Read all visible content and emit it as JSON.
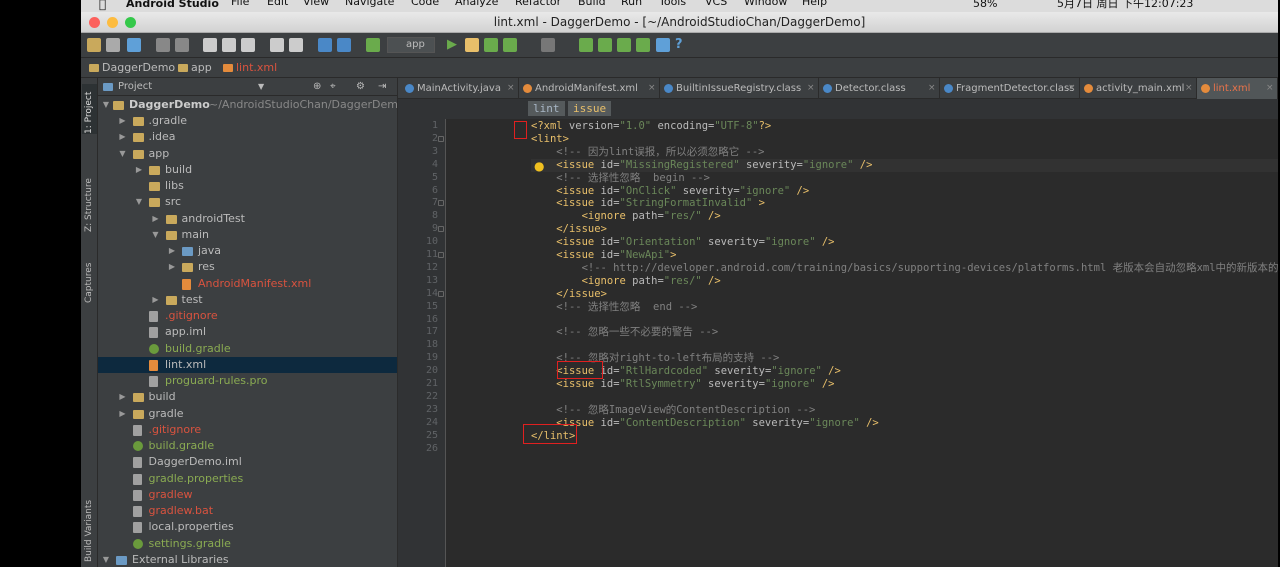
{
  "menubar": {
    "app": "Android Studio",
    "items": [
      "File",
      "Edit",
      "View",
      "Navigate",
      "Code",
      "Analyze",
      "Refactor",
      "Build",
      "Run",
      "Tools",
      "VCS",
      "Window",
      "Help"
    ],
    "battery": "58%",
    "clock": "5月7日 周日 下午12:07:23"
  },
  "window": {
    "title": "lint.xml - DaggerDemo - [~/AndroidStudioChan/DaggerDemo]"
  },
  "toolbar": {
    "run_config": "app",
    "icons": [
      "open-icon",
      "save-icon",
      "sync-icon",
      "undo-icon",
      "redo-icon",
      "cut-icon",
      "copy-icon",
      "paste-icon",
      "find-icon",
      "replace-icon",
      "back-icon",
      "forward-icon",
      "make-icon",
      "run-icon",
      "apply-changes-icon",
      "debug-icon",
      "coverage-icon",
      "stop-icon",
      "sdk-manager-icon",
      "avd-manager-icon",
      "gradle-sync-icon",
      "android-monitor-icon",
      "project-structure-icon",
      "help-icon"
    ]
  },
  "navbar": {
    "crumbs": [
      "DaggerDemo",
      "app",
      "lint.xml"
    ]
  },
  "leftstrip": {
    "tabs": [
      "1: Project",
      "Z: Structure",
      "Captures",
      "Build Variants"
    ]
  },
  "project": {
    "header": "Project",
    "root": "DaggerDemo",
    "root_path": "~/AndroidStudioChan/DaggerDemo",
    "items": [
      {
        "label": ".gradle",
        "depth": 1,
        "arrow": "▶",
        "icon": "f",
        "color": "c-white"
      },
      {
        "label": ".idea",
        "depth": 1,
        "arrow": "▶",
        "icon": "f",
        "color": "c-white"
      },
      {
        "label": "app",
        "depth": 1,
        "arrow": "▼",
        "icon": "f",
        "color": "c-white"
      },
      {
        "label": "build",
        "depth": 2,
        "arrow": "▶",
        "icon": "f",
        "color": "c-white"
      },
      {
        "label": "libs",
        "depth": 2,
        "arrow": "",
        "icon": "f",
        "color": "c-white"
      },
      {
        "label": "src",
        "depth": 2,
        "arrow": "▼",
        "icon": "f",
        "color": "c-white"
      },
      {
        "label": "androidTest",
        "depth": 3,
        "arrow": "▶",
        "icon": "f",
        "color": "c-white"
      },
      {
        "label": "main",
        "depth": 3,
        "arrow": "▼",
        "icon": "f",
        "color": "c-white"
      },
      {
        "label": "java",
        "depth": 4,
        "arrow": "▶",
        "icon": "fb",
        "color": "c-white"
      },
      {
        "label": "res",
        "depth": 4,
        "arrow": "▶",
        "icon": "f",
        "color": "c-white"
      },
      {
        "label": "AndroidManifest.xml",
        "depth": 4,
        "arrow": "",
        "icon": "xml",
        "color": "c-red"
      },
      {
        "label": "test",
        "depth": 3,
        "arrow": "▶",
        "icon": "f",
        "color": "c-white"
      },
      {
        "label": ".gitignore",
        "depth": 2,
        "arrow": "",
        "icon": "file",
        "color": "c-red"
      },
      {
        "label": "app.iml",
        "depth": 2,
        "arrow": "",
        "icon": "file",
        "color": "c-white"
      },
      {
        "label": "build.gradle",
        "depth": 2,
        "arrow": "",
        "icon": "grad",
        "color": "c-green"
      },
      {
        "label": "lint.xml",
        "depth": 2,
        "arrow": "",
        "icon": "xml",
        "color": "c-white",
        "selected": true
      },
      {
        "label": "proguard-rules.pro",
        "depth": 2,
        "arrow": "",
        "icon": "file",
        "color": "c-green"
      },
      {
        "label": "build",
        "depth": 1,
        "arrow": "▶",
        "icon": "f",
        "color": "c-white"
      },
      {
        "label": "gradle",
        "depth": 1,
        "arrow": "▶",
        "icon": "f",
        "color": "c-white"
      },
      {
        "label": ".gitignore",
        "depth": 1,
        "arrow": "",
        "icon": "file",
        "color": "c-red"
      },
      {
        "label": "build.gradle",
        "depth": 1,
        "arrow": "",
        "icon": "grad",
        "color": "c-green"
      },
      {
        "label": "DaggerDemo.iml",
        "depth": 1,
        "arrow": "",
        "icon": "file",
        "color": "c-white"
      },
      {
        "label": "gradle.properties",
        "depth": 1,
        "arrow": "",
        "icon": "file",
        "color": "c-green"
      },
      {
        "label": "gradlew",
        "depth": 1,
        "arrow": "",
        "icon": "file",
        "color": "c-red"
      },
      {
        "label": "gradlew.bat",
        "depth": 1,
        "arrow": "",
        "icon": "file",
        "color": "c-red"
      },
      {
        "label": "local.properties",
        "depth": 1,
        "arrow": "",
        "icon": "file",
        "color": "c-white"
      },
      {
        "label": "settings.gradle",
        "depth": 1,
        "arrow": "",
        "icon": "grad",
        "color": "c-green"
      },
      {
        "label": "External Libraries",
        "depth": 0,
        "arrow": "▼",
        "icon": "fb",
        "color": "c-white"
      }
    ]
  },
  "tabs": [
    {
      "label": "MainActivity.java",
      "color": "#4a88c7"
    },
    {
      "label": "AndroidManifest.xml",
      "color": "#e48b3c"
    },
    {
      "label": "BuiltinIssueRegistry.class",
      "color": "#4a88c7"
    },
    {
      "label": "Detector.class",
      "color": "#4a88c7"
    },
    {
      "label": "FragmentDetector.class",
      "color": "#4a88c7"
    },
    {
      "label": "activity_main.xml",
      "color": "#e48b3c"
    },
    {
      "label": "lint.xml",
      "color": "#e48b3c",
      "active": true
    }
  ],
  "breadcrumb_tags": [
    "lint",
    "issue"
  ],
  "editor": {
    "lines": [
      "<?xml version=\"1.0\" encoding=\"UTF-8\"?>",
      "<lint>",
      "    <!-- 因为lint误报，所以必须忽略它 -->",
      "    <issue id=\"MissingRegistered\" severity=\"ignore\" />",
      "    <!-- 选择性忽略  begin -->",
      "    <issue id=\"OnClick\" severity=\"ignore\" />",
      "    <issue id=\"StringFormatInvalid\" >",
      "        <ignore path=\"res/\" />",
      "    </issue>",
      "    <issue id=\"Orientation\" severity=\"ignore\" />",
      "    <issue id=\"NewApi\">",
      "        <!-- http://developer.android.com/training/basics/supporting-devices/platforms.html 老版本会自动忽略xml中的新版本的属",
      "        <ignore path=\"res/\" />",
      "    </issue>",
      "    <!-- 选择性忽略  end -->",
      "",
      "    <!-- 忽略一些不必要的警告 -->",
      "",
      "    <!-- 忽略对right-to-left布局的支持 -->",
      "    <issue id=\"RtlHardcoded\" severity=\"ignore\" />",
      "    <issue id=\"RtlSymmetry\" severity=\"ignore\" />",
      "",
      "    <!-- 忽略ImageView的ContentDescription -->",
      "    <issue id=\"ContentDescription\" severity=\"ignore\" />",
      "</lint>",
      ""
    ]
  }
}
